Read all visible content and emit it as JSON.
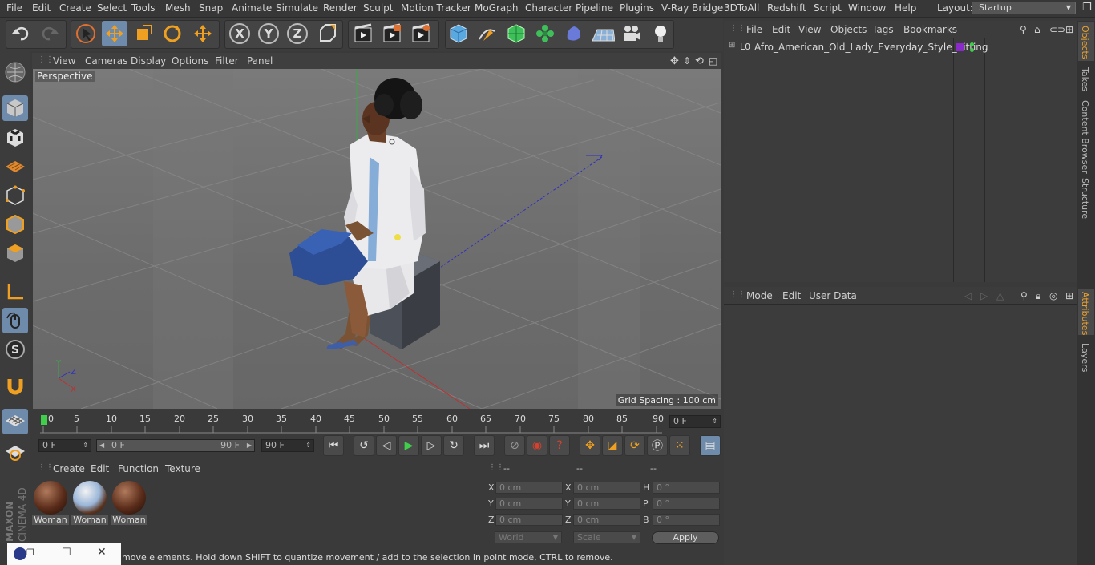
{
  "menubar": {
    "items": [
      "File",
      "Edit",
      "Create",
      "Select",
      "Tools",
      "Mesh",
      "Snap",
      "Animate",
      "Simulate",
      "Render",
      "Sculpt",
      "Motion Tracker",
      "MoGraph",
      "Character",
      "Pipeline",
      "Plugins",
      "V-Ray Bridge",
      "3DToAll",
      "Redshift",
      "Script",
      "Window",
      "Help"
    ],
    "layout_label": "Layout:",
    "layout_value": "Startup"
  },
  "toolbar": {
    "axis_x": "X",
    "axis_y": "Y",
    "axis_z": "Z"
  },
  "viewport": {
    "menu": [
      "View",
      "Cameras",
      "Display",
      "Options",
      "Filter",
      "Panel"
    ],
    "camera_label": "Perspective",
    "grid_spacing": "Grid Spacing : 100 cm",
    "axis_x": "X",
    "axis_y": "Y",
    "axis_z": "Z"
  },
  "timeline": {
    "ticks": [
      "0",
      "5",
      "10",
      "15",
      "20",
      "25",
      "30",
      "35",
      "40",
      "45",
      "50",
      "55",
      "60",
      "65",
      "70",
      "75",
      "80",
      "85",
      "90"
    ],
    "current_frame": "0 F"
  },
  "transport": {
    "start_field": "0 F",
    "range_start": "0 F",
    "range_end": "90 F",
    "end_field": "90 F"
  },
  "materials": {
    "menu": [
      "Create",
      "Edit",
      "Function",
      "Texture"
    ],
    "items": [
      "Woman",
      "Woman",
      "Woman"
    ]
  },
  "coordinates": {
    "header": [
      "--",
      "--",
      "--"
    ],
    "pos_labels": [
      "X",
      "Y",
      "Z"
    ],
    "pos_values": [
      "0 cm",
      "0 cm",
      "0 cm"
    ],
    "size_labels": [
      "X",
      "Y",
      "Z"
    ],
    "size_values": [
      "0 cm",
      "0 cm",
      "0 cm"
    ],
    "rot_labels": [
      "H",
      "P",
      "B"
    ],
    "rot_values": [
      "0 °",
      "0 °",
      "0 °"
    ],
    "mode_select": "World",
    "scale_select": "Scale",
    "apply": "Apply"
  },
  "status": {
    "text": "move elements. Hold down SHIFT to quantize movement / add to the selection in point mode, CTRL to remove."
  },
  "object_manager": {
    "menu": [
      "File",
      "Edit",
      "View",
      "Objects",
      "Tags",
      "Bookmarks"
    ],
    "object_name": "Afro_American_Old_Lady_Everyday_Style_Sitting"
  },
  "attribute_manager": {
    "menu": [
      "Mode",
      "Edit",
      "User Data"
    ]
  },
  "side_tabs": [
    "Objects",
    "Takes",
    "Content Browser",
    "Structure",
    "Attributes",
    "Layers"
  ],
  "brand": {
    "maxon": "MAXON",
    "product": "CINEMA 4D"
  },
  "colors": {
    "accent": "#6f8bab",
    "play": "#3fcf4a",
    "record": "#d9402c"
  }
}
